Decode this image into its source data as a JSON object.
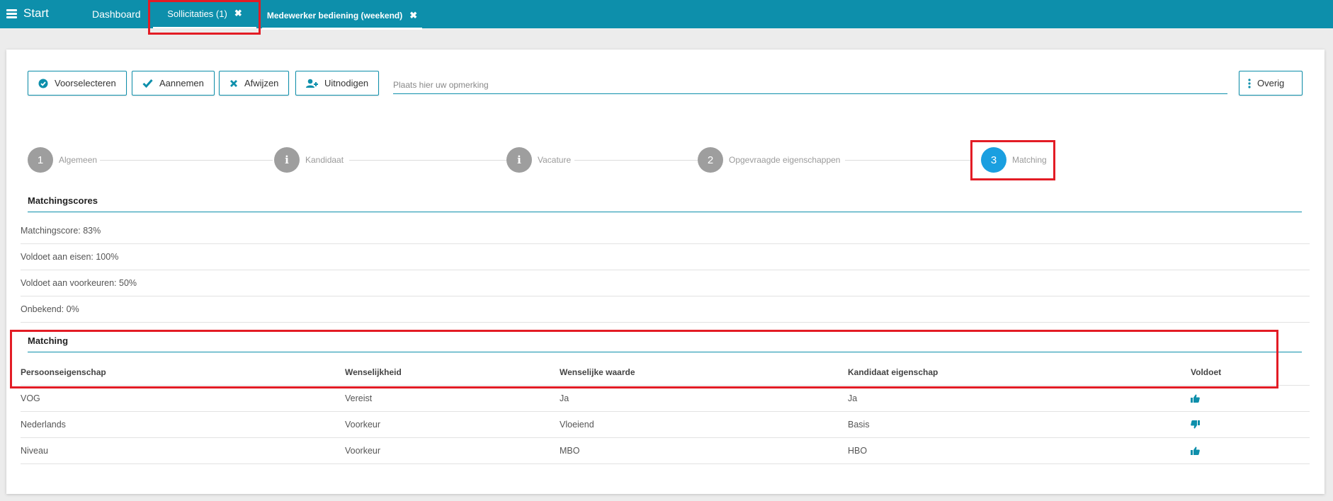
{
  "header": {
    "start_label": "Start",
    "tabs": [
      {
        "label": "Dashboard"
      },
      {
        "label": "Sollicitaties (1)",
        "close": "✖"
      },
      {
        "label": "Medewerker bediening (weekend)",
        "close": "✖"
      }
    ]
  },
  "toolbar": {
    "buttons": [
      {
        "label": "Voorselecteren",
        "icon": "check-circle-icon"
      },
      {
        "label": "Aannemen",
        "icon": "checkmark-icon"
      },
      {
        "label": "Afwijzen",
        "icon": "x-icon"
      },
      {
        "label": "Uitnodigen",
        "icon": "user-plus-icon"
      }
    ],
    "remark_placeholder": "Plaats hier uw opmerking",
    "overig_label": "Overig"
  },
  "stepper": {
    "steps": [
      {
        "badge": "1",
        "label": "Algemeen"
      },
      {
        "badge": "i",
        "label": "Kandidaat"
      },
      {
        "badge": "i",
        "label": "Vacature"
      },
      {
        "badge": "2",
        "label": "Opgevraagde eigenschappen"
      },
      {
        "badge": "3",
        "label": "Matching",
        "current": true
      }
    ]
  },
  "matchingscores": {
    "title": "Matchingscores",
    "rows": [
      "Matchingscore: 83%",
      "Voldoet aan eisen: 100%",
      "Voldoet aan voorkeuren: 50%",
      "Onbekend: 0%"
    ]
  },
  "matching": {
    "title": "Matching",
    "columns": [
      "Persoonseigenschap",
      "Wenselijkheid",
      "Wenselijke waarde",
      "Kandidaat eigenschap",
      "Voldoet"
    ],
    "rows": [
      {
        "eigenschap": "VOG",
        "wenselijkheid": "Vereist",
        "waarde": "Ja",
        "kandidaat": "Ja",
        "voldoet": "thumbs-up-icon"
      },
      {
        "eigenschap": "Nederlands",
        "wenselijkheid": "Voorkeur",
        "waarde": "Vloeiend",
        "kandidaat": "Basis",
        "voldoet": "thumbs-down-icon"
      },
      {
        "eigenschap": "Niveau",
        "wenselijkheid": "Voorkeur",
        "waarde": "MBO",
        "kandidaat": "HBO",
        "voldoet": "thumbs-up-icon"
      }
    ]
  },
  "colors": {
    "topbar": "#0d8fab",
    "accent": "#0d8fab",
    "current_step": "#1a9fe0",
    "highlight": "#e31c25"
  }
}
